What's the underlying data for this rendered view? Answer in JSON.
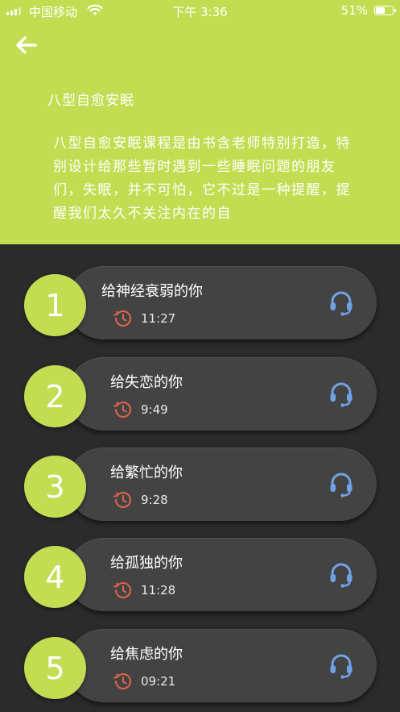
{
  "status": {
    "carrier": "中国移动",
    "time": "下午 3:36",
    "battery": "51%"
  },
  "course": {
    "title": "八型自愈安眠",
    "description": "八型自愈安眠课程是由书含老师特别打造，特别设计给那些暂时遇到一些睡眠问题的朋友们，失眠，并不可怕，它不过是一种提醒，提醒我们太久不关注内在的自"
  },
  "tracks": [
    {
      "number": "1",
      "title": "给神经衰弱的你",
      "duration": "11:27"
    },
    {
      "number": "2",
      "title": "给失恋的你",
      "duration": "9:49"
    },
    {
      "number": "3",
      "title": "给繁忙的你",
      "duration": "9:28"
    },
    {
      "number": "4",
      "title": "给孤独的你",
      "duration": "11:28"
    },
    {
      "number": "5",
      "title": "给焦虑的你",
      "duration": "09:21"
    }
  ],
  "colors": {
    "accent": "#c3dd52",
    "background": "#2b2b2b",
    "pill": "#444344",
    "clock": "#e0654b",
    "headphone": "#6fa3e6"
  },
  "icons": {
    "back": "arrow-left-icon",
    "clock": "history-clock-icon",
    "play": "headphone-icon"
  }
}
